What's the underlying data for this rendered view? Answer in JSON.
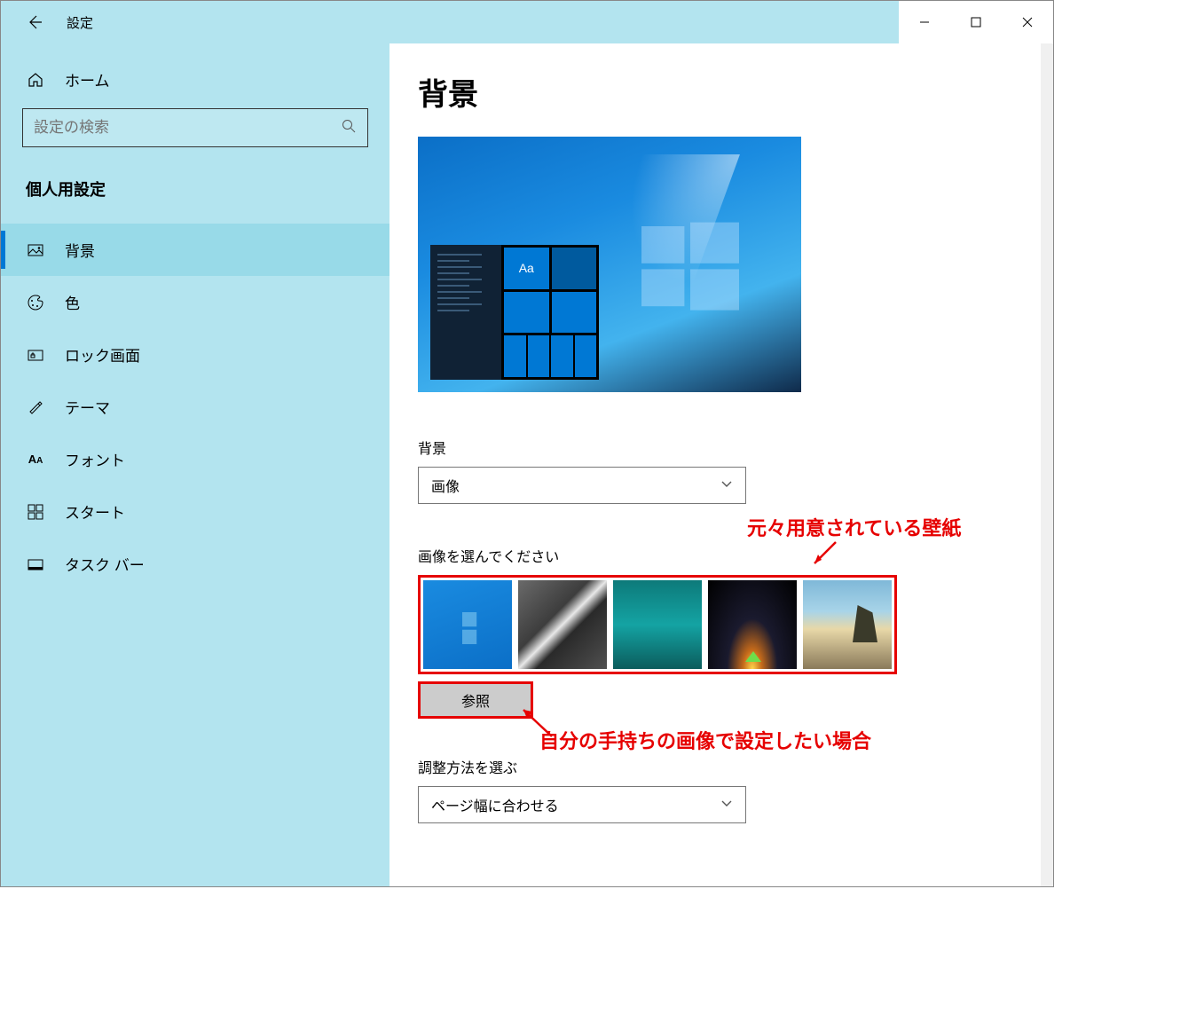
{
  "titlebar": {
    "title": "設定"
  },
  "sidebar": {
    "home": "ホーム",
    "search_placeholder": "設定の検索",
    "section": "個人用設定",
    "items": [
      {
        "icon": "image-icon",
        "label": "背景",
        "active": true
      },
      {
        "icon": "palette-icon",
        "label": "色"
      },
      {
        "icon": "lock-screen-icon",
        "label": "ロック画面"
      },
      {
        "icon": "theme-icon",
        "label": "テーマ"
      },
      {
        "icon": "font-icon",
        "label": "フォント"
      },
      {
        "icon": "start-icon",
        "label": "スタート"
      },
      {
        "icon": "taskbar-icon",
        "label": "タスク バー"
      }
    ]
  },
  "content": {
    "title": "背景",
    "preview_sample_text": "Aa",
    "bg_label": "背景",
    "bg_value": "画像",
    "choose_label": "画像を選んでください",
    "browse": "参照",
    "fit_label": "調整方法を選ぶ",
    "fit_value": "ページ幅に合わせる"
  },
  "annotations": {
    "a1": "元々用意されている壁紙",
    "a2": "自分の手持ちの画像で設定したい場合"
  }
}
